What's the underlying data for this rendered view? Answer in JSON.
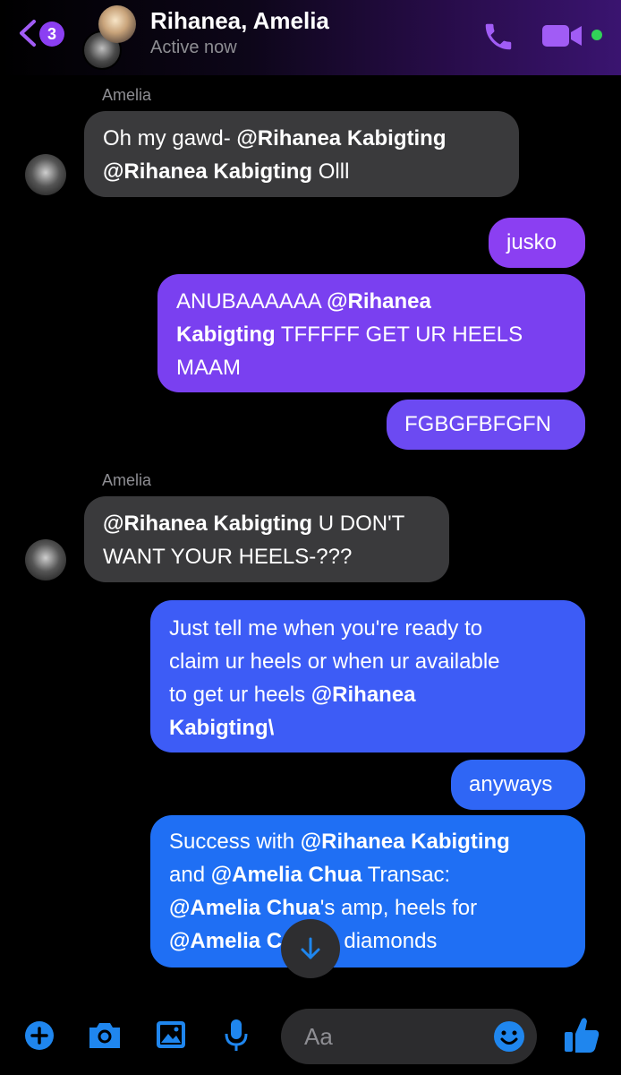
{
  "header": {
    "back_badge": "3",
    "title": "Rihanea, Amelia",
    "subtitle": "Active now",
    "icons": [
      "back-chevron-icon",
      "phone-icon",
      "video-camera-icon"
    ],
    "online_color": "#31d158"
  },
  "messages": [
    {
      "sender": "Amelia",
      "direction": "incoming",
      "line1": [
        "Oh my gawd- ",
        "@Rihanea Kabigting"
      ],
      "line2": [
        "@Rihanea Kabigting",
        " Olll"
      ]
    },
    {
      "direction": "outgoing",
      "text": "jusko"
    },
    {
      "direction": "outgoing",
      "line1": [
        "ANUBAAAAAA ",
        "@Rihanea"
      ],
      "line2": [
        "Kabigting",
        " TFFFFF GET UR HEELS"
      ],
      "line3": "MAAM"
    },
    {
      "direction": "outgoing",
      "text": "FGBGFBFGFN"
    },
    {
      "sender": "Amelia",
      "direction": "incoming",
      "line1": [
        "@Rihanea Kabigting",
        " U DON'T"
      ],
      "line2": "WANT YOUR HEELS-???"
    },
    {
      "direction": "outgoing",
      "line1": "Just tell me when you're ready to",
      "line2": "claim ur heels or when ur available",
      "line3": [
        "to get ur heels ",
        "@Rihanea"
      ],
      "line4": "Kabigting\\"
    },
    {
      "direction": "outgoing",
      "text": "anyways"
    },
    {
      "direction": "outgoing",
      "line1": [
        "Success with ",
        "@Rihanea Kabigting"
      ],
      "line2": [
        "and ",
        "@Amelia Chua",
        " Transac:"
      ],
      "line3": [
        "@Amelia Chua",
        "'s amp, heels for"
      ],
      "line4": [
        "@Amelia C",
        "'s diamonds"
      ]
    }
  ],
  "composer": {
    "placeholder": "Aa",
    "icons": [
      "plus-icon",
      "camera-icon",
      "photo-icon",
      "microphone-icon",
      "emoji-icon",
      "thumbs-up-icon"
    ]
  },
  "colors": {
    "accent": "#8b3ff2",
    "incoming_bubble": "#3a3a3c",
    "composer_icons": "#1f86ee"
  }
}
